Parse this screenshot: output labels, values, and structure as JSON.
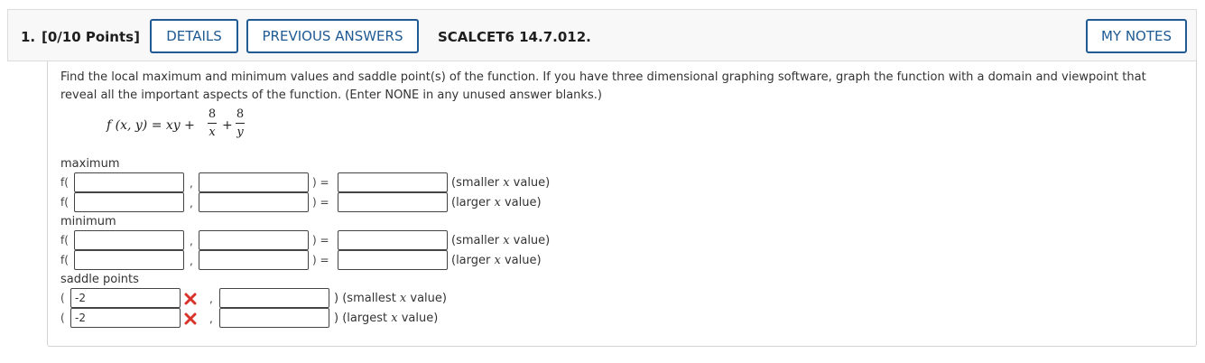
{
  "header": {
    "number": "1.",
    "points": "[0/10 Points]",
    "details_label": "DETAILS",
    "prev_answers_label": "PREVIOUS ANSWERS",
    "problem_id": "SCALCET6 14.7.012.",
    "my_notes_label": "MY NOTES"
  },
  "question": {
    "line1": "Find the local maximum and minimum values and saddle point(s) of the function. If you have three dimensional graphing software, graph the function with a domain and viewpoint that",
    "line2": "reveal all the important aspects of the function. (Enter NONE in any unused answer blanks.)"
  },
  "formula": {
    "lhs": "f (x, y) = xy +",
    "plus": "+",
    "frac1_num": "8",
    "frac1_den": "x",
    "frac2_num": "8",
    "frac2_den": "y"
  },
  "sections": {
    "maximum": "maximum",
    "minimum": "minimum",
    "saddle": "saddle points"
  },
  "labels": {
    "f_open": "f(",
    "comma": ",",
    "close_eq": ") =",
    "paren_open": "(",
    "paren_close": ")",
    "smaller_pre": "(smaller ",
    "larger_pre": "(larger ",
    "smallest_pre": "(smallest ",
    "largest_pre": "(largest ",
    "x": "x",
    "value_post": " value)"
  },
  "saddle_values": {
    "row1_x": "-2",
    "row2_x": "-2"
  },
  "colors": {
    "brand": "#1f5a93",
    "incorrect": "#d9342b"
  },
  "icons": {
    "incorrect": "x-mark-icon"
  }
}
